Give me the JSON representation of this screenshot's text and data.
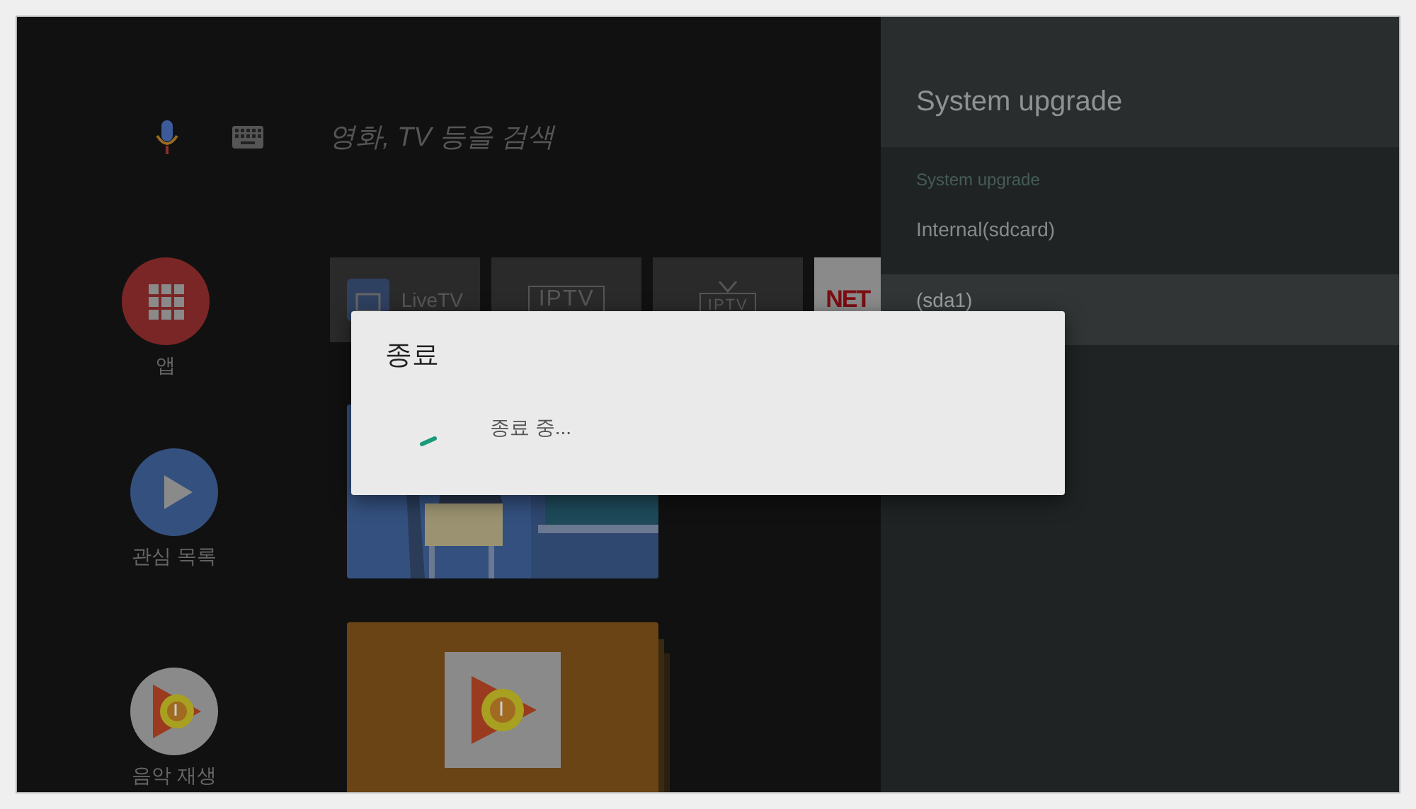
{
  "search": {
    "placeholder": "영화, TV 등을 검색"
  },
  "launcher": {
    "rows": [
      {
        "nav": {
          "kind": "apps",
          "label": "앱"
        },
        "tiles": [
          {
            "kind": "livetv",
            "label": "LiveTV"
          },
          {
            "kind": "iptv",
            "label": "IPTV"
          },
          {
            "kind": "tv",
            "label": "IPTV"
          },
          {
            "kind": "netflix",
            "label": "NET"
          }
        ]
      },
      {
        "nav": {
          "kind": "watchlist",
          "label": "관심 목록"
        }
      },
      {
        "nav": {
          "kind": "music",
          "label": "음악 재생"
        },
        "cards": [
          {
            "kind": "music"
          }
        ]
      }
    ]
  },
  "panel": {
    "title": "System upgrade",
    "category": "System upgrade",
    "items": [
      {
        "label": "Internal(sdcard)",
        "selected": false
      },
      {
        "label": "(sda1)",
        "selected": true
      }
    ]
  },
  "dialog": {
    "title": "종료",
    "message": "종료 중..."
  }
}
